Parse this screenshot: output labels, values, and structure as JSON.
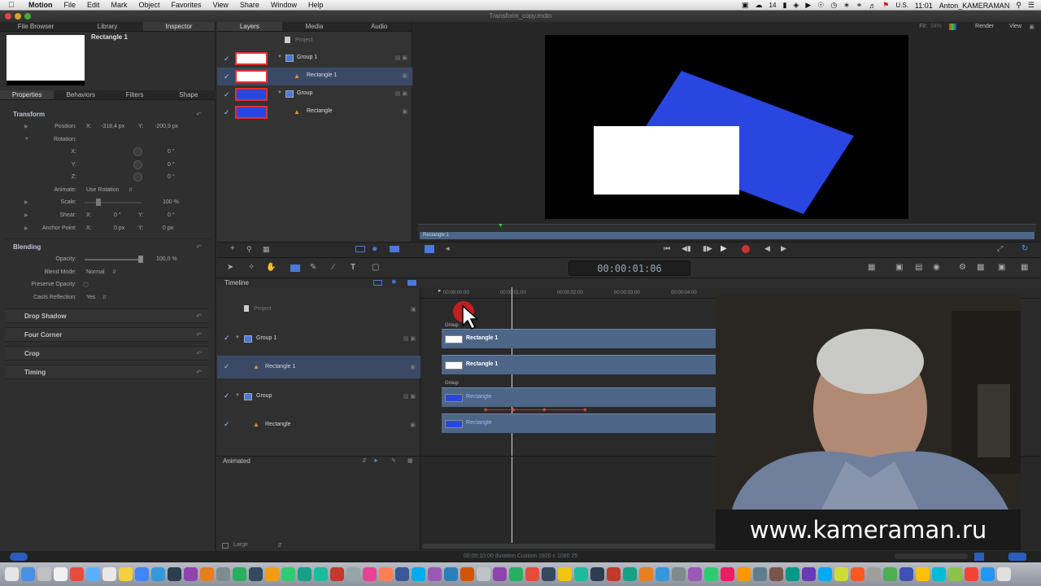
{
  "menubar": {
    "app": "Motion",
    "items": [
      "File",
      "Edit",
      "Mark",
      "Object",
      "Favorites",
      "View",
      "Share",
      "Window",
      "Help"
    ],
    "status_left": "14",
    "keyboard": "U.S.",
    "time": "11:01",
    "user": "Anton_KAMERAMAN"
  },
  "window": {
    "title": "Transform_copy.motn"
  },
  "inspector": {
    "tabs": [
      "File Browser",
      "Library",
      "Inspector"
    ],
    "object_title": "Rectangle 1",
    "subtabs": [
      "Properties",
      "Behaviors",
      "Filters",
      "Shape"
    ],
    "transform": {
      "heading": "Transform",
      "position_label": "Position:",
      "x_label": "X:",
      "y_label": "Y:",
      "z_label": "Z:",
      "position_x": "-318,4 px",
      "position_y": "-200,9 px",
      "rotation_label": "Rotation:",
      "rot_x": "0 °",
      "rot_y": "0 °",
      "rot_z": "0 °",
      "animate_label": "Animate:",
      "animate_value": "Use Rotation",
      "scale_label": "Scale:",
      "scale_value": "100 %",
      "shear_label": "Shear:",
      "shear_x": "0 °",
      "shear_y": "0 °",
      "anchor_label": "Anchor Point:",
      "anchor_x": "0 px",
      "anchor_y": "0 px"
    },
    "blending": {
      "heading": "Blending",
      "opacity_label": "Opacity:",
      "opacity_value": "100,0 %",
      "blend_mode_label": "Blend Mode:",
      "blend_mode_value": "Normal",
      "preserve_label": "Preserve Opacity:",
      "casts_label": "Casts Reflection:",
      "casts_value": "Yes"
    },
    "collapsed": [
      "Drop Shadow",
      "Four Corner",
      "Crop",
      "Timing"
    ]
  },
  "layers_panel": {
    "tabs": [
      "Layers",
      "Media",
      "Audio"
    ],
    "project_label": "Project",
    "rows": [
      {
        "name": "Group 1",
        "thumb": "#ffffff"
      },
      {
        "name": "Rectangle 1",
        "thumb": "#ffffff"
      },
      {
        "name": "Group",
        "thumb": "#2a46e0"
      },
      {
        "name": "Rectangle",
        "thumb": "#2a46e0"
      }
    ]
  },
  "viewer": {
    "fit_label": "Fit:",
    "fit_value": "34%",
    "render_menu": "Render",
    "view_menu": "View",
    "mini_track_label": "Rectangle 1"
  },
  "toolbar": {
    "timecode": "00:00:01:06"
  },
  "timeline": {
    "title": "Timeline",
    "ticks": [
      "00:00:00:00",
      "00:00:01:00",
      "00:00:02:00",
      "00:00:03:00",
      "00:00:04:00"
    ],
    "project_label": "Project",
    "rows": [
      "Group 1",
      "Rectangle 1",
      "Group",
      "Rectangle"
    ],
    "group_tag_1": "Group",
    "group_tag_2": "Group",
    "track_rect1_a": "Rectangle 1",
    "track_rect1_b": "Rectangle 1",
    "track_rect_a": "Rectangle",
    "track_rect_b": "Rectangle"
  },
  "animation_editor": {
    "mode": "Animated",
    "size": "Large"
  },
  "statusbar": {
    "text": "00:00:10:00 duration Custom 1920 x 1080 25"
  },
  "overlay": {
    "watermark": "www.kameraman.ru"
  },
  "colors": {
    "selection": "#3a4a66",
    "track": "#4d6687",
    "rect_blue": "#2a46e0",
    "accent_red": "#e03030"
  },
  "dock_colors": [
    "#e5e5e5",
    "#4a90e2",
    "#c0c0c0",
    "#f0f0f0",
    "#e74c3c",
    "#5ab0ff",
    "#e8e8e8",
    "#f4d03f",
    "#4285f4",
    "#3498db",
    "#2c3e50",
    "#8e44ad",
    "#e67e22",
    "#7f8c8d",
    "#27ae60",
    "#34495e",
    "#f39c12",
    "#2ecc71",
    "#16a085",
    "#1abc9c",
    "#c0392b",
    "#95a5a6",
    "#e84393",
    "#ff7f50",
    "#3b5998",
    "#00aced",
    "#9b59b6",
    "#2980b9",
    "#d35400",
    "#bdc3c7",
    "#8e44ad",
    "#27ae60",
    "#e74c3c",
    "#34495e",
    "#f1c40f",
    "#1abc9c",
    "#2c3e50",
    "#c0392b",
    "#16a085",
    "#e67e22",
    "#3498db",
    "#7f8c8d",
    "#9b59b6",
    "#2ecc71",
    "#e91e63",
    "#ff9800",
    "#607d8b",
    "#795548",
    "#009688",
    "#673ab7",
    "#03a9f4",
    "#cddc39",
    "#ff5722",
    "#9e9e9e",
    "#4caf50",
    "#3f51b5",
    "#ffc107",
    "#00bcd4",
    "#8bc34a",
    "#f44336",
    "#2196f3",
    "#e0e0e0"
  ]
}
